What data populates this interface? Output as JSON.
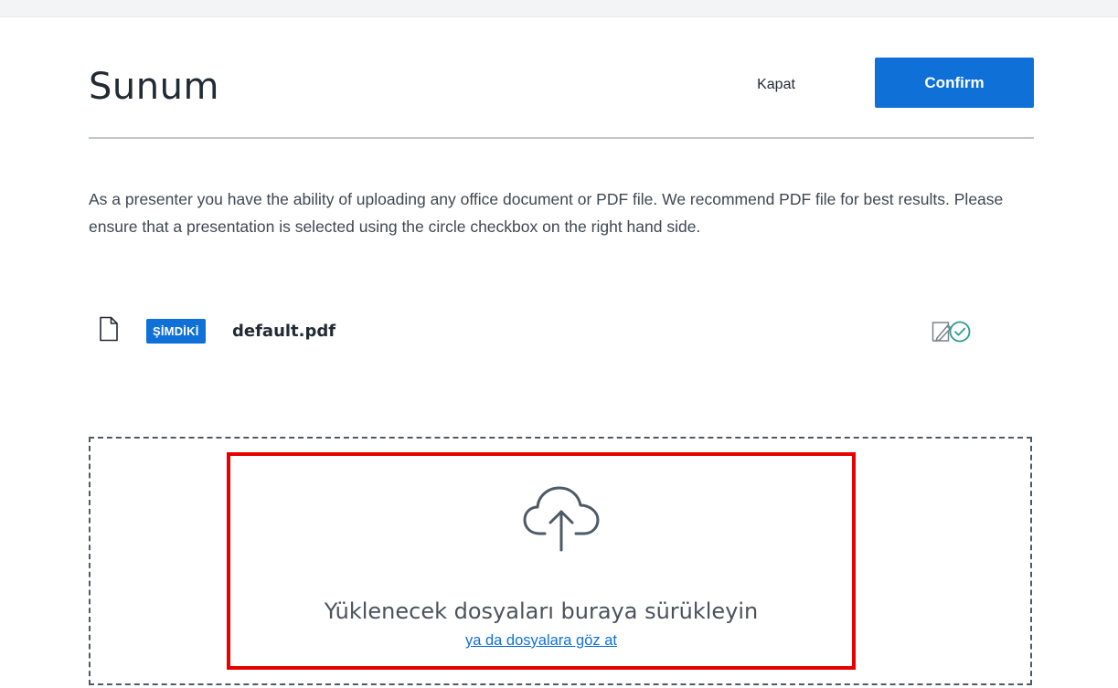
{
  "modal": {
    "title": "Sunum",
    "close_label": "Kapat",
    "confirm_label": "Confirm"
  },
  "description": "As a presenter you have the ability of uploading any office document or PDF file. We recommend PDF file for best results. Please ensure that a presentation is selected using the circle checkbox on the right hand side.",
  "files": [
    {
      "badge": "ŞİMDİKİ",
      "name": "default.pdf",
      "icon": "file-icon",
      "actions": [
        "edit-icon",
        "check-circle-icon"
      ]
    }
  ],
  "dropzone": {
    "icon": "cloud-upload-icon",
    "text": "Yüklenecek dosyaları buraya sürükleyin",
    "browse_label": "ya da dosyalara göz at"
  },
  "colors": {
    "accent": "#0f70d7",
    "highlight": "#e60000",
    "check": "#2a9d8f"
  }
}
